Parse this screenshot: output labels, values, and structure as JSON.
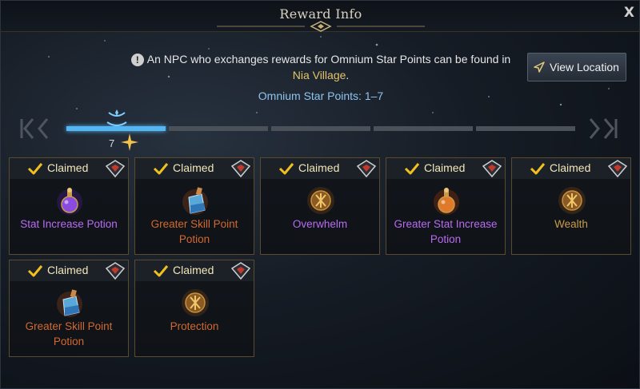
{
  "window": {
    "title": "Reward Info",
    "close_label": "X"
  },
  "notice": {
    "line1": "An NPC who exchanges rewards for Omnium Star Points can be found in",
    "location": "Nia Village",
    "line_end": "."
  },
  "view_location_button": {
    "label": "View Location",
    "icon": "compass-icon"
  },
  "points_range_label": "Omnium Star Points: 1–7",
  "progress": {
    "current_points": "7",
    "active_segments": 1,
    "total_segments": 5,
    "accent": "#56b6f2"
  },
  "rewards": [
    {
      "status": "Claimed",
      "name_line1": "Stat Increase Potion",
      "name_line2": "",
      "name_color": "#b76cf0",
      "icon": "purple-potion-icon"
    },
    {
      "status": "Claimed",
      "name_line1": "Greater Skill Point",
      "name_line2": "Potion",
      "name_color": "#d2692f",
      "icon": "blue-potion-bottle-icon"
    },
    {
      "status": "Claimed",
      "name_line1": "Overwhelm",
      "name_line2": "",
      "name_color": "#b76cf0",
      "icon": "rune-icon"
    },
    {
      "status": "Claimed",
      "name_line1": "Greater Stat Increase",
      "name_line2": "Potion",
      "name_color": "#b76cf0",
      "icon": "orange-potion-icon"
    },
    {
      "status": "Claimed",
      "name_line1": "Wealth",
      "name_line2": "",
      "name_color": "#c99b4c",
      "icon": "rune-icon"
    },
    {
      "status": "Claimed",
      "name_line1": "Greater Skill Point",
      "name_line2": "Potion",
      "name_color": "#d2692f",
      "icon": "blue-potion-bottle-icon"
    },
    {
      "status": "Claimed",
      "name_line1": "Protection",
      "name_line2": "",
      "name_color": "#d2692f",
      "icon": "rune-icon"
    }
  ]
}
